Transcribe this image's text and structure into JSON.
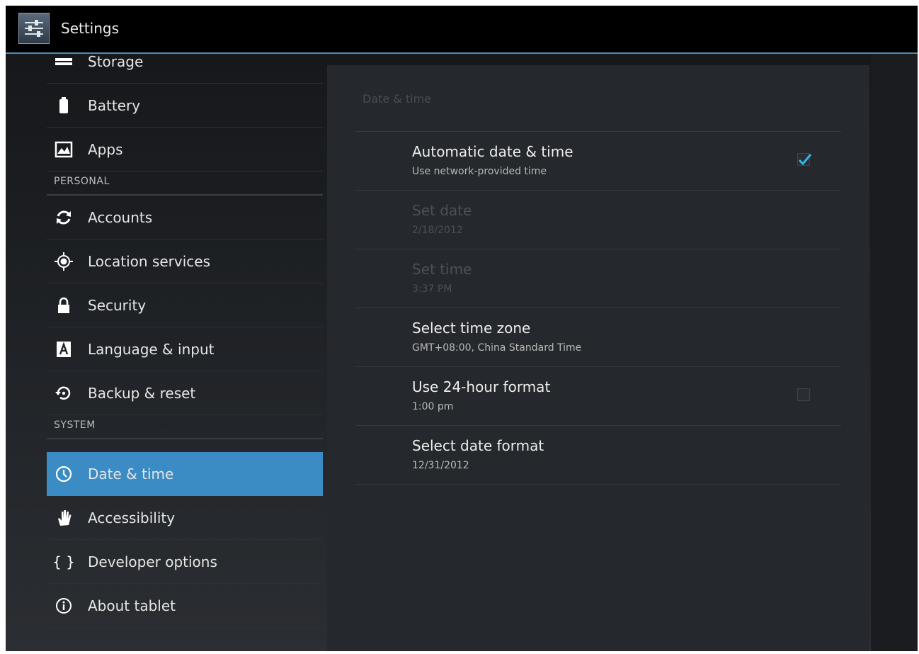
{
  "app": {
    "title": "Settings"
  },
  "sidebar": {
    "items": [
      {
        "type": "item",
        "label": "Storage",
        "icon": "storage-icon"
      },
      {
        "type": "item",
        "label": "Battery",
        "icon": "battery-icon"
      },
      {
        "type": "item",
        "label": "Apps",
        "icon": "apps-icon"
      },
      {
        "type": "header",
        "label": "PERSONAL"
      },
      {
        "type": "item",
        "label": "Accounts",
        "icon": "sync-icon"
      },
      {
        "type": "item",
        "label": "Location services",
        "icon": "location-icon"
      },
      {
        "type": "item",
        "label": "Security",
        "icon": "lock-icon"
      },
      {
        "type": "item",
        "label": "Language & input",
        "icon": "keyboard-a-icon"
      },
      {
        "type": "item",
        "label": "Backup & reset",
        "icon": "backup-icon"
      },
      {
        "type": "header",
        "label": "SYSTEM"
      },
      {
        "type": "item",
        "label": "Date & time",
        "icon": "clock-icon",
        "selected": true
      },
      {
        "type": "item",
        "label": "Accessibility",
        "icon": "hand-icon"
      },
      {
        "type": "item",
        "label": "Developer options",
        "icon": "braces-icon"
      },
      {
        "type": "item",
        "label": "About tablet",
        "icon": "info-icon"
      }
    ]
  },
  "detail": {
    "title": "Date & time",
    "prefs": [
      {
        "title": "Automatic date & time",
        "summary": "Use network-provided time",
        "checkbox": true,
        "checked": true,
        "enabled": true
      },
      {
        "title": "Set date",
        "summary": "2/18/2012",
        "enabled": false
      },
      {
        "title": "Set time",
        "summary": "3:37 PM",
        "enabled": false
      },
      {
        "title": "Select time zone",
        "summary": "GMT+08:00, China Standard Time",
        "enabled": true
      },
      {
        "title": "Use 24-hour format",
        "summary": "1:00 pm",
        "checkbox": true,
        "checked": false,
        "enabled": true
      },
      {
        "title": "Select date format",
        "summary": "12/31/2012",
        "enabled": true
      }
    ]
  },
  "colors": {
    "accent": "#3b8bc4",
    "check": "#33b5e5"
  }
}
